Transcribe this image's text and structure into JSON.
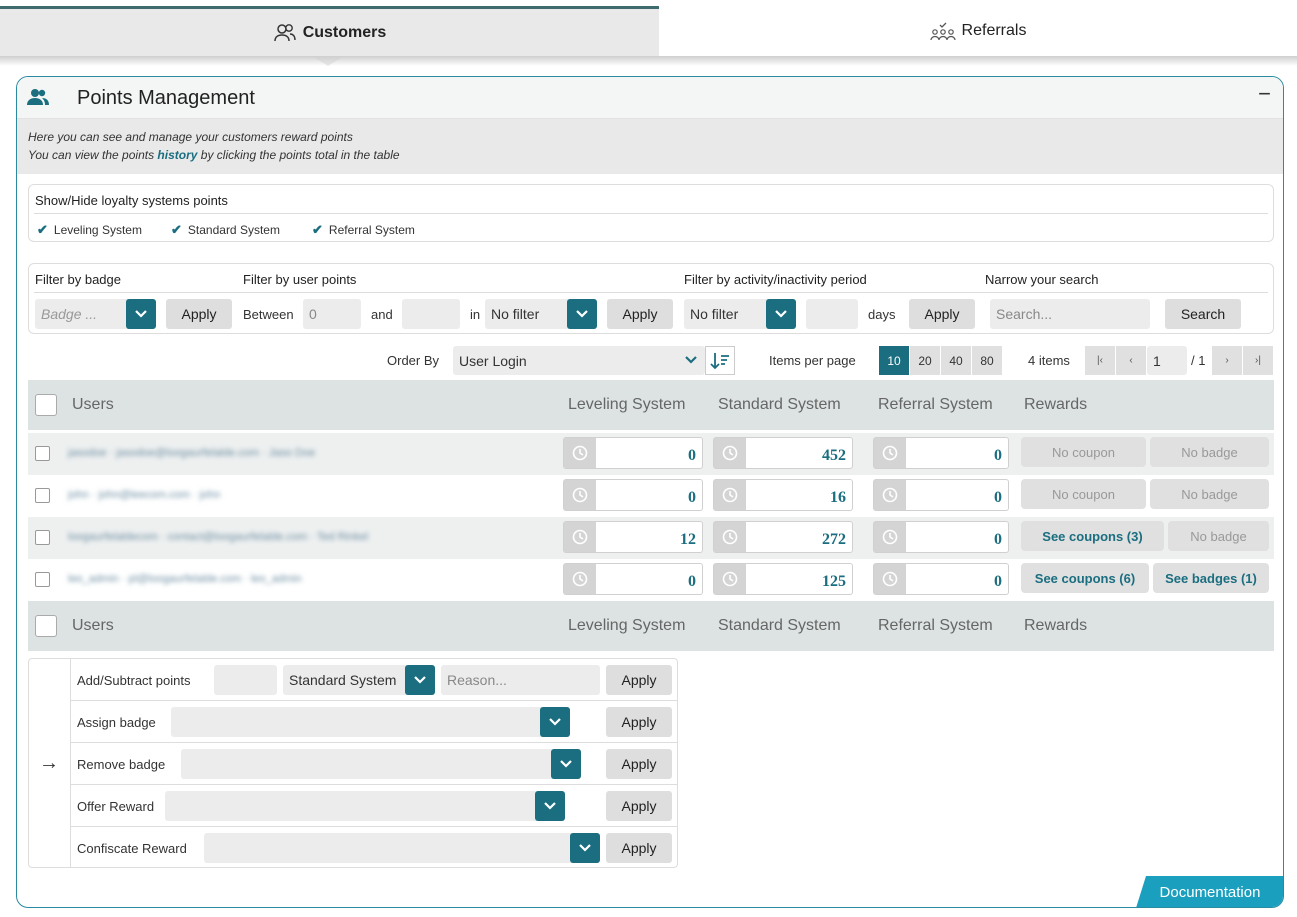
{
  "tabs": [
    {
      "label": "Customers",
      "icon": "users-icon",
      "active": true
    },
    {
      "label": "Referrals",
      "icon": "referral-icon",
      "active": false
    }
  ],
  "panel": {
    "title": "Points Management",
    "collapse": "−",
    "intro_line1": "Here you can see and manage your customers reward points",
    "intro_line2_pre": "You can view the points ",
    "intro_line2_link": "history",
    "intro_line2_post": " by clicking the points total in the table"
  },
  "loyalty": {
    "title": "Show/Hide loyalty systems points",
    "items": [
      "Leveling System",
      "Standard System",
      "Referral System"
    ]
  },
  "filters": {
    "badge_label": "Filter by badge",
    "badge_placeholder": "Badge ...",
    "points_label": "Filter by user points",
    "between": "Between",
    "min_value": "0",
    "and": "and",
    "in": "in",
    "points_system": "No filter",
    "activity_label": "Filter by activity/inactivity period",
    "activity_value": "No filter",
    "days": "days",
    "search_label": "Narrow your search",
    "search_placeholder": "Search...",
    "search_btn": "Search",
    "apply": "Apply"
  },
  "order": {
    "label": "Order By",
    "value": "User Login",
    "items_per_page_label": "Items per page",
    "page_sizes": [
      "10",
      "20",
      "40",
      "80"
    ],
    "items_count": "4 items",
    "page": "1",
    "page_total": "/ 1"
  },
  "table": {
    "headers": [
      "Users",
      "Leveling System",
      "Standard System",
      "Referral System",
      "Rewards"
    ],
    "rows": [
      {
        "user": "jasodoe · jasodoe@loogaurfelalde.com · Jaso Doe",
        "leveling": "0",
        "standard": "452",
        "referral": "0",
        "coupons": "No coupon",
        "badges": "No badge"
      },
      {
        "user": "john · john@leecom.com · john",
        "leveling": "0",
        "standard": "16",
        "referral": "0",
        "coupons": "No coupon",
        "badges": "No badge"
      },
      {
        "user": "loogaurfelaldecom · contact@loogaurfelalde.com · Ted Rinkel",
        "leveling": "12",
        "standard": "272",
        "referral": "0",
        "coupons": "See coupons (3)",
        "badges": "No badge"
      },
      {
        "user": "leo_admin · pl@loogaurfelalde.com · leo_admin",
        "leveling": "0",
        "standard": "125",
        "referral": "0",
        "coupons": "See coupons (6)",
        "badges": "See badges (1)"
      }
    ]
  },
  "bulk": {
    "add_label": "Add/Subtract points",
    "system_value": "Standard System",
    "reason_placeholder": "Reason...",
    "assign_label": "Assign badge",
    "remove_label": "Remove badge",
    "offer_label": "Offer Reward",
    "confiscate_label": "Confiscate Reward",
    "apply": "Apply"
  },
  "documentation": "Documentation",
  "colors": {
    "accent": "#1a6e80",
    "doc": "#1aa0be",
    "border": "#2a8aa0"
  }
}
